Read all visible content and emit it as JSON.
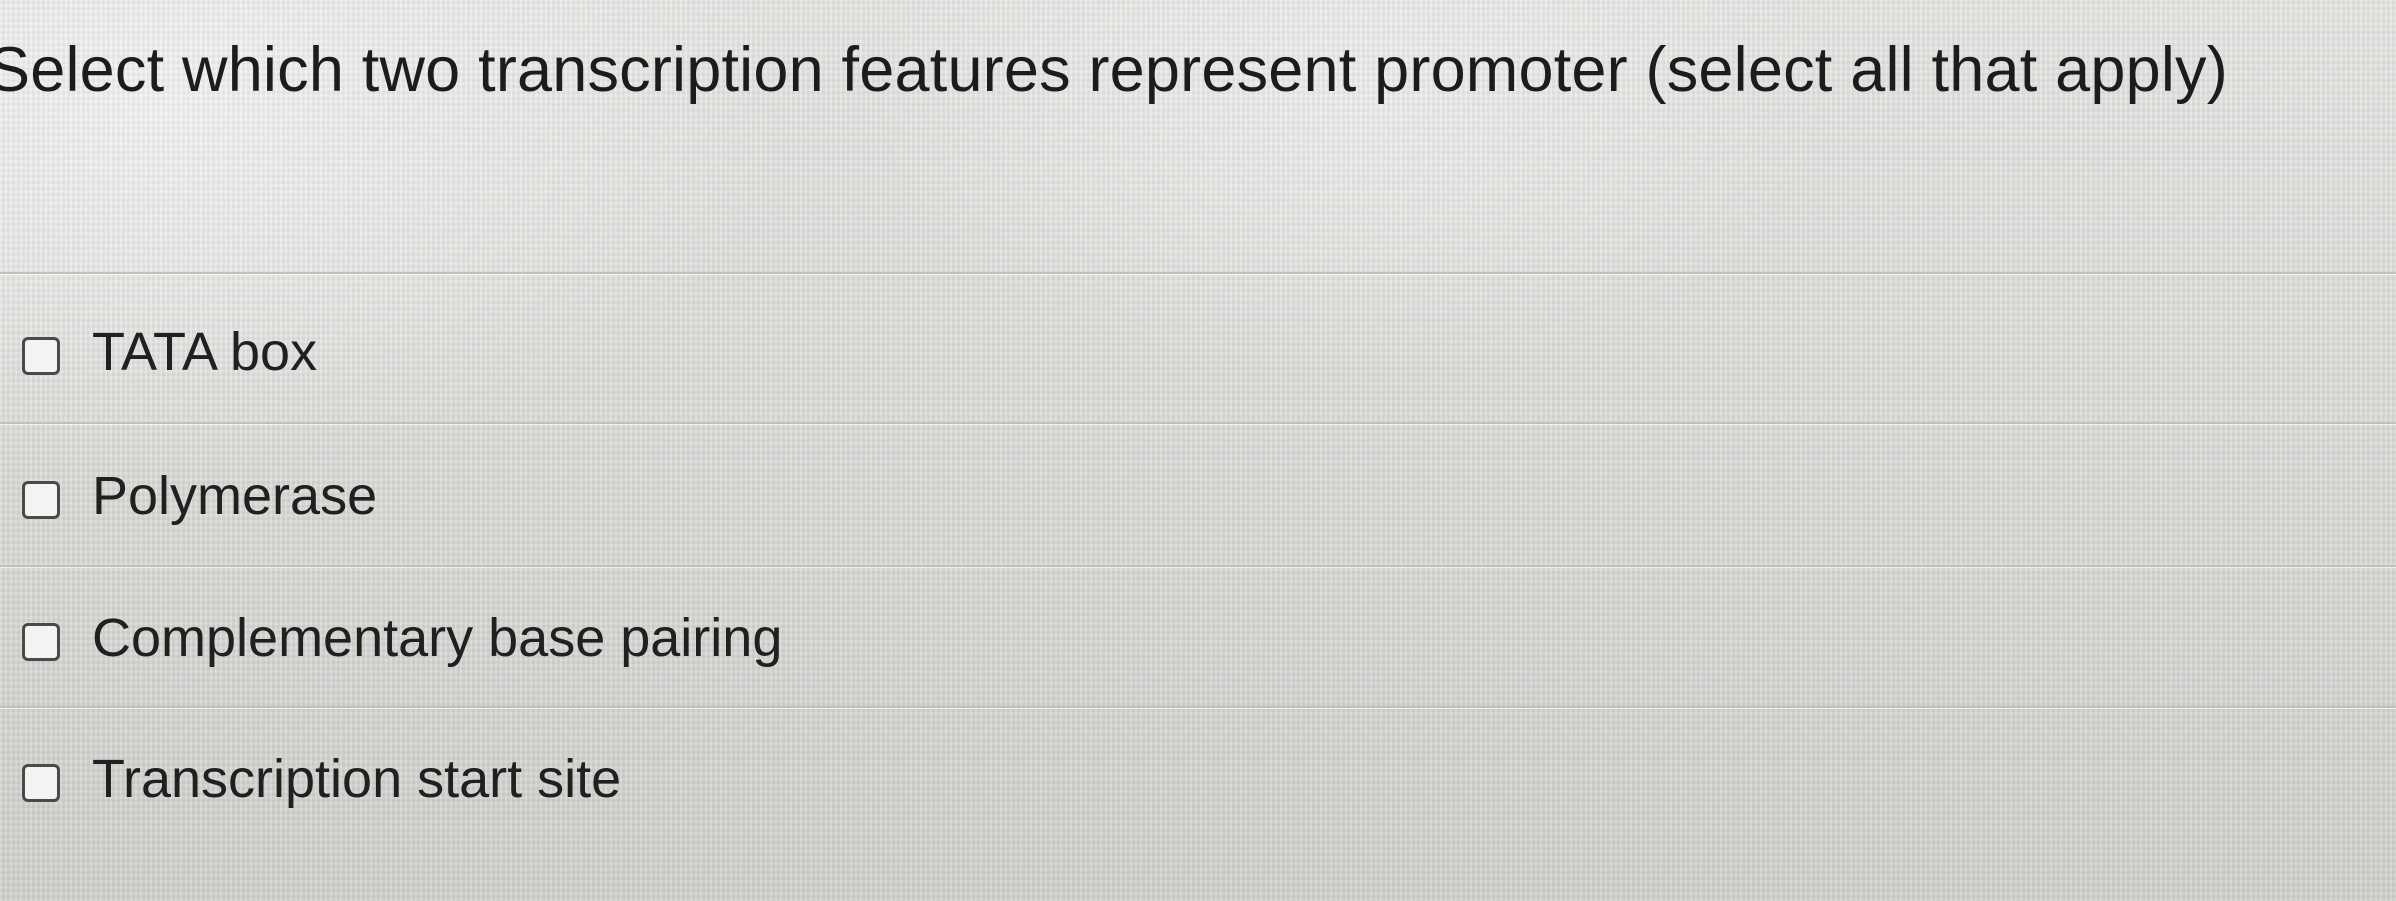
{
  "question": {
    "text": "Select which two transcription features represent promoter (select all that apply)"
  },
  "options": [
    {
      "label": "TATA box",
      "checked": false
    },
    {
      "label": "Polymerase",
      "checked": false
    },
    {
      "label": "Complementary base pairing",
      "checked": false
    },
    {
      "label": "Transcription start site",
      "checked": false
    }
  ]
}
